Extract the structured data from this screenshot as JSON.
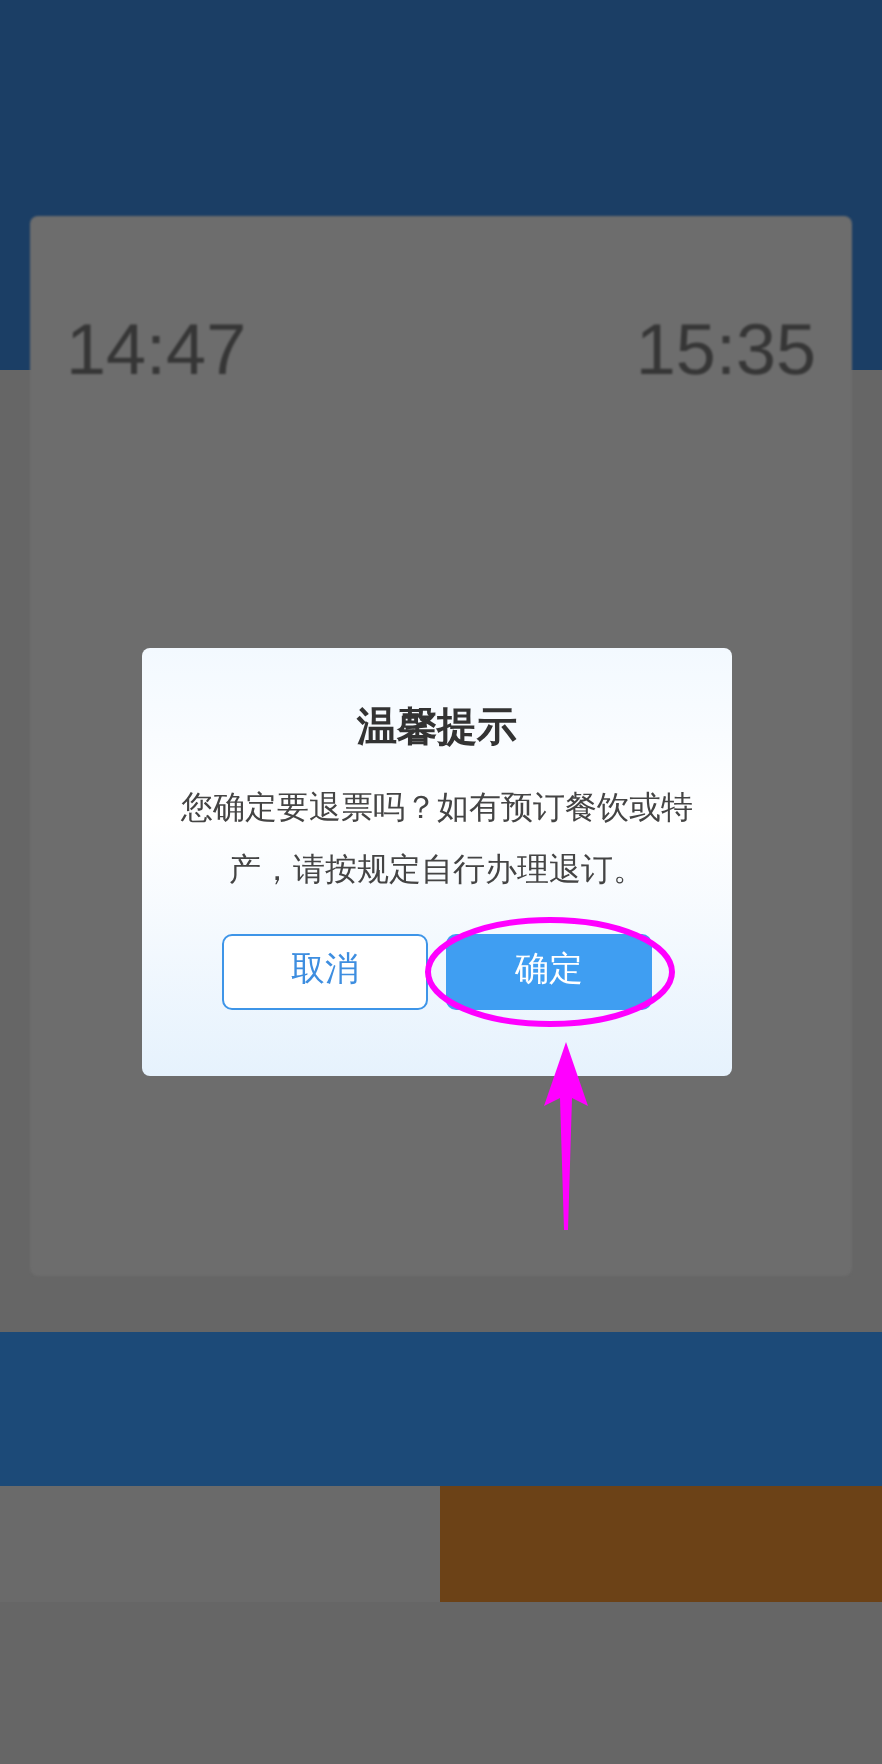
{
  "background": {
    "departure_time": "14:47",
    "arrival_time": "15:35"
  },
  "dialog": {
    "title": "温馨提示",
    "message": "您确定要退票吗？如有预订餐饮或特产，请按规定自行办理退订。",
    "buttons": [
      {
        "label": "取消",
        "kind": "secondary",
        "highlighted": false
      },
      {
        "label": "确定",
        "kind": "primary",
        "highlighted": true
      }
    ]
  }
}
